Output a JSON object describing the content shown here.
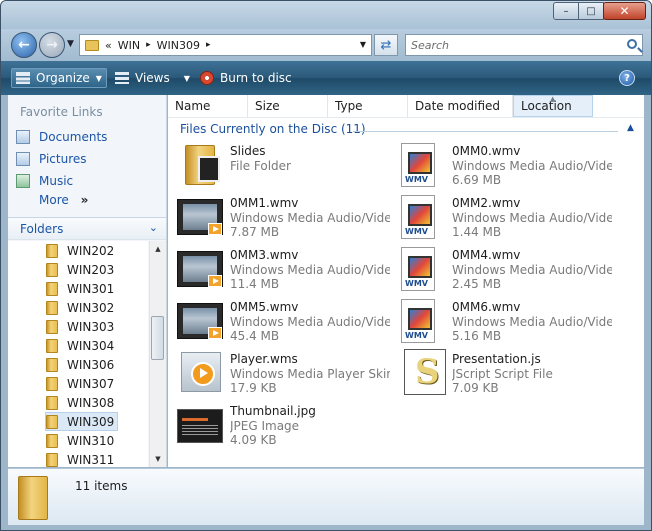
{
  "window": {
    "title": "",
    "minimize": "–",
    "maximize": "□",
    "close": "✕"
  },
  "address": {
    "overflow": "«",
    "crumbs": [
      "WIN",
      "WIN309"
    ],
    "separator": "▸"
  },
  "search": {
    "placeholder": "Search"
  },
  "toolbar": {
    "organize": "Organize",
    "views": "Views",
    "burn": "Burn to disc",
    "help": "?"
  },
  "nav": {
    "favorites_title": "Favorite Links",
    "links": [
      "Documents",
      "Pictures",
      "Music"
    ],
    "more": "More",
    "more_chevron": "»",
    "folders_title": "Folders",
    "tree": [
      "WIN202",
      "WIN203",
      "WIN301",
      "WIN302",
      "WIN303",
      "WIN304",
      "WIN306",
      "WIN307",
      "WIN308",
      "WIN309",
      "WIN310",
      "WIN311"
    ],
    "selected": "WIN309"
  },
  "columns": [
    "Name",
    "Size",
    "Type",
    "Date modified",
    "Location"
  ],
  "group": {
    "title": "Files Currently on the Disc (11)"
  },
  "files": [
    {
      "name": "Slides",
      "type": "File Folder",
      "size": "",
      "icon": "folder-icon"
    },
    {
      "name": "0MM0.wmv",
      "type": "Windows Media Audio/Vide...",
      "size": "6.69 MB",
      "icon": "wmv-file-icon"
    },
    {
      "name": "0MM1.wmv",
      "type": "Windows Media Audio/Vide...",
      "size": "7.87 MB",
      "icon": "video-thumbnail-icon"
    },
    {
      "name": "0MM2.wmv",
      "type": "Windows Media Audio/Vide...",
      "size": "1.44 MB",
      "icon": "wmv-file-icon"
    },
    {
      "name": "0MM3.wmv",
      "type": "Windows Media Audio/Vide...",
      "size": "11.4 MB",
      "icon": "video-thumbnail-icon"
    },
    {
      "name": "0MM4.wmv",
      "type": "Windows Media Audio/Vide...",
      "size": "2.45 MB",
      "icon": "wmv-file-icon"
    },
    {
      "name": "0MM5.wmv",
      "type": "Windows Media Audio/Vide...",
      "size": "45.4 MB",
      "icon": "video-thumbnail-icon"
    },
    {
      "name": "0MM6.wmv",
      "type": "Windows Media Audio/Vide...",
      "size": "5.16 MB",
      "icon": "wmv-file-icon"
    },
    {
      "name": "Player.wms",
      "type": "Windows Media Player Skin ...",
      "size": "17.9 KB",
      "icon": "media-player-skin-icon"
    },
    {
      "name": "Presentation.js",
      "type": "JScript Script File",
      "size": "7.09 KB",
      "icon": "jscript-file-icon"
    },
    {
      "name": "Thumbnail.jpg",
      "type": "JPEG Image",
      "size": "4.09 KB",
      "icon": "jpeg-thumbnail-icon"
    }
  ],
  "details": {
    "count": "11 items"
  },
  "icons": {
    "back": "back-arrow-icon",
    "forward": "forward-arrow-icon",
    "refresh": "refresh-icon",
    "search": "search-icon"
  }
}
